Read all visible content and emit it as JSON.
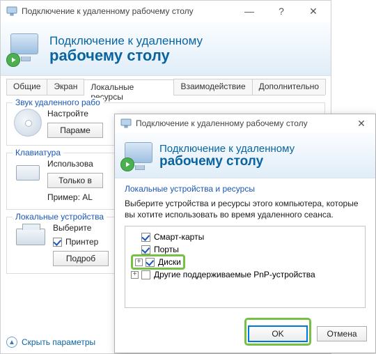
{
  "back": {
    "title": "Подключение к удаленному рабочему столу",
    "banner_l1": "Подключение к удаленному",
    "banner_l2": "рабочему столу",
    "tabs": [
      "Общие",
      "Экран",
      "Локальные ресурсы",
      "Взаимодействие",
      "Дополнительно"
    ],
    "active_tab": 2,
    "group_audio": {
      "legend": "Звук удаленного рабо",
      "line": "Настройте",
      "button": "Параме"
    },
    "group_keyboard": {
      "legend": "Клавиатура",
      "line": "Использова",
      "button": "Только в",
      "hint": "Пример: AL"
    },
    "group_devices": {
      "legend": "Локальные устройства",
      "line": "Выберите",
      "checkbox": "Принтер",
      "button": "Подроб"
    },
    "footer": "Скрыть параметры"
  },
  "front": {
    "title": "Подключение к удаленному рабочему столу",
    "banner_l1": "Подключение к удаленному",
    "banner_l2": "рабочему столу",
    "legend": "Локальные устройства и ресурсы",
    "desc": "Выберите устройства и ресурсы этого компьютера, которые вы хотите использовать во время удаленного сеанса.",
    "tree": [
      {
        "expander": false,
        "checked": true,
        "label": "Смарт-карты",
        "highlight": false
      },
      {
        "expander": false,
        "checked": true,
        "label": "Порты",
        "highlight": false
      },
      {
        "expander": true,
        "checked": true,
        "label": "Диски",
        "highlight": true
      },
      {
        "expander": true,
        "checked": false,
        "label": "Другие поддерживаемые PnP-устройства",
        "highlight": false
      }
    ],
    "ok": "OK",
    "cancel": "Отмена"
  }
}
